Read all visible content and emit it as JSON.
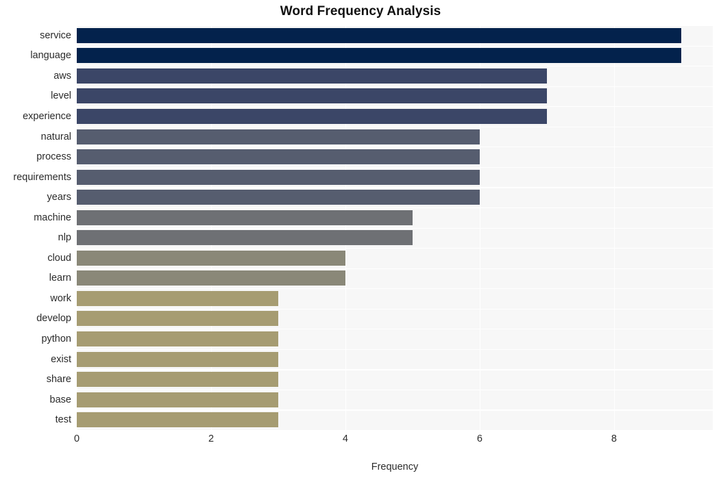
{
  "chart_data": {
    "type": "bar",
    "orientation": "horizontal",
    "title": "Word Frequency Analysis",
    "xlabel": "Frequency",
    "ylabel": "",
    "categories": [
      "service",
      "language",
      "aws",
      "level",
      "experience",
      "natural",
      "process",
      "requirements",
      "years",
      "machine",
      "nlp",
      "cloud",
      "learn",
      "work",
      "develop",
      "python",
      "exist",
      "share",
      "base",
      "test"
    ],
    "values": [
      9,
      9,
      7,
      7,
      7,
      6,
      6,
      6,
      6,
      5,
      5,
      4,
      4,
      3,
      3,
      3,
      3,
      3,
      3,
      3
    ],
    "bar_colors": [
      "#03224c",
      "#03224c",
      "#3b4667",
      "#3b4667",
      "#3b4667",
      "#565d6f",
      "#565d6f",
      "#565d6f",
      "#565d6f",
      "#6e7074",
      "#6e7074",
      "#8a8878",
      "#8a8878",
      "#a69c72",
      "#a69c72",
      "#a69c72",
      "#a69c72",
      "#a69c72",
      "#a69c72",
      "#a69c72"
    ],
    "xlim": [
      0,
      9.47
    ],
    "ylim_count": 20,
    "xticks": [
      0,
      2,
      4,
      6,
      8
    ],
    "xtick_labels": [
      "0",
      "2",
      "4",
      "6",
      "8"
    ],
    "grid": true,
    "grid_color": "#ffffff",
    "plot_background": "#f7f7f7",
    "figure_background": "#ffffff",
    "legend": null,
    "legend_position": "none",
    "annotations": []
  }
}
